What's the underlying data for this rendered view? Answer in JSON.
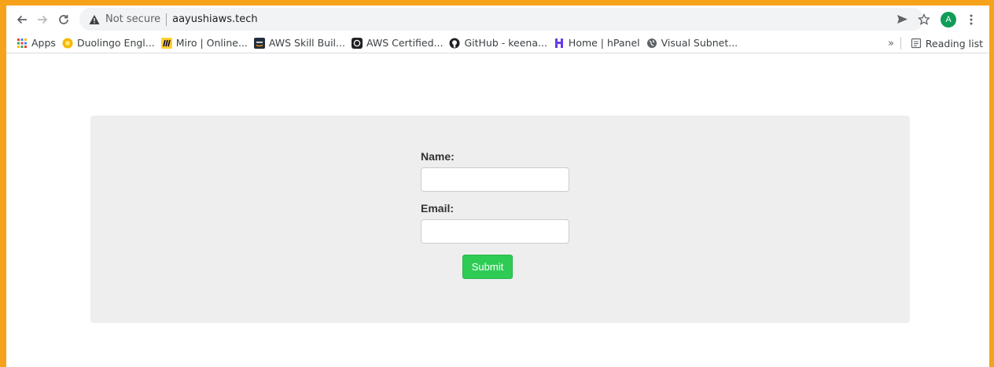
{
  "browser": {
    "security_text": "Not secure",
    "url": "aayushiaws.tech",
    "avatar_letter": "A",
    "icons": [
      "back-arrow-icon",
      "forward-arrow-icon",
      "reload-icon",
      "warning-icon",
      "send-icon",
      "star-icon",
      "menu-icon"
    ]
  },
  "bookmarks": {
    "items": [
      {
        "label": "Apps",
        "icon": "apps-grid-icon"
      },
      {
        "label": "Duolingo Engl...",
        "icon": "duolingo-icon"
      },
      {
        "label": "Miro | Online...",
        "icon": "miro-icon"
      },
      {
        "label": "AWS Skill Buil...",
        "icon": "aws-icon"
      },
      {
        "label": "AWS Certified...",
        "icon": "aws-certified-icon"
      },
      {
        "label": "GitHub - keena...",
        "icon": "github-icon"
      },
      {
        "label": "Home | hPanel",
        "icon": "hostinger-icon"
      },
      {
        "label": "Visual Subnet...",
        "icon": "globe-icon"
      }
    ],
    "overflow": "»",
    "reading_list": "Reading list"
  },
  "form": {
    "name_label": "Name:",
    "name_value": "",
    "email_label": "Email:",
    "email_value": "",
    "submit_label": "Submit"
  },
  "colors": {
    "frame": "#f7a21b",
    "panel": "#eeeeee",
    "submit": "#2ecc55",
    "avatar": "#0f9d58"
  }
}
